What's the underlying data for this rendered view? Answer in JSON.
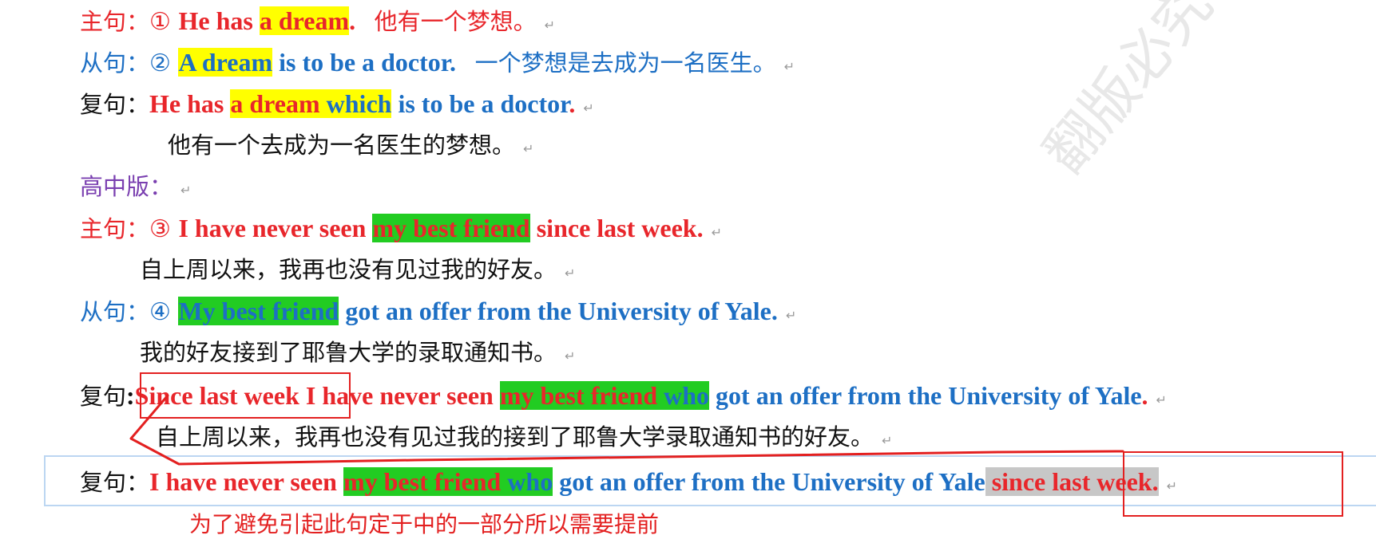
{
  "watermark": "翻版必究",
  "rows": {
    "r1": {
      "label": "主句：",
      "num": "①",
      "p1": "He has ",
      "hl": "a dream",
      "p2": ".",
      "zh": "他有一个梦想。"
    },
    "r2": {
      "label": "从句：",
      "num": "②",
      "hl": "A dream",
      "p1": " is to be a doctor.",
      "zh": "一个梦想是去成为一名医生。"
    },
    "r3": {
      "label": "复句：",
      "p1": "He has ",
      "hl1": "a dream",
      "hl2": " which",
      "p2": " is to be a doctor",
      "dot": "."
    },
    "r4": {
      "zh": "他有一个去成为一名医生的梦想。"
    },
    "r5": {
      "label": "高中版："
    },
    "r6": {
      "label": "主句：",
      "num": "③",
      "p1": "I have never seen ",
      "hl": "my best friend",
      "p2": " since last week."
    },
    "r7": {
      "zh": "自上周以来，我再也没有见过我的好友。"
    },
    "r8": {
      "label": "从句：",
      "num": "④",
      "hl": "My best friend",
      "p1": " got an offer from the University of Yale."
    },
    "r9": {
      "zh": "我的好友接到了耶鲁大学的录取通知书。"
    },
    "r10": {
      "label": "复句",
      "colon": ":",
      "boxed": "Since last week",
      "p1": " I have never seen ",
      "hl1": "my best friend",
      "hl2": " who",
      "p2": " got an offer from the University of Yale",
      "dot": "."
    },
    "r11": {
      "zh": "自上周以来，我再也没有见过我的接到了耶鲁大学录取通知书的好友。"
    },
    "r12": {
      "label": "复句",
      "colon": "：",
      "p1": "I have never seen ",
      "hl1": "my best friend",
      "hl2": " who",
      "p2": " got an offer from the University of Yale",
      "hl3": " since last week."
    }
  },
  "note": "为了避免引起此句定于中的一部分所以需要提前",
  "para_mark": "↵"
}
